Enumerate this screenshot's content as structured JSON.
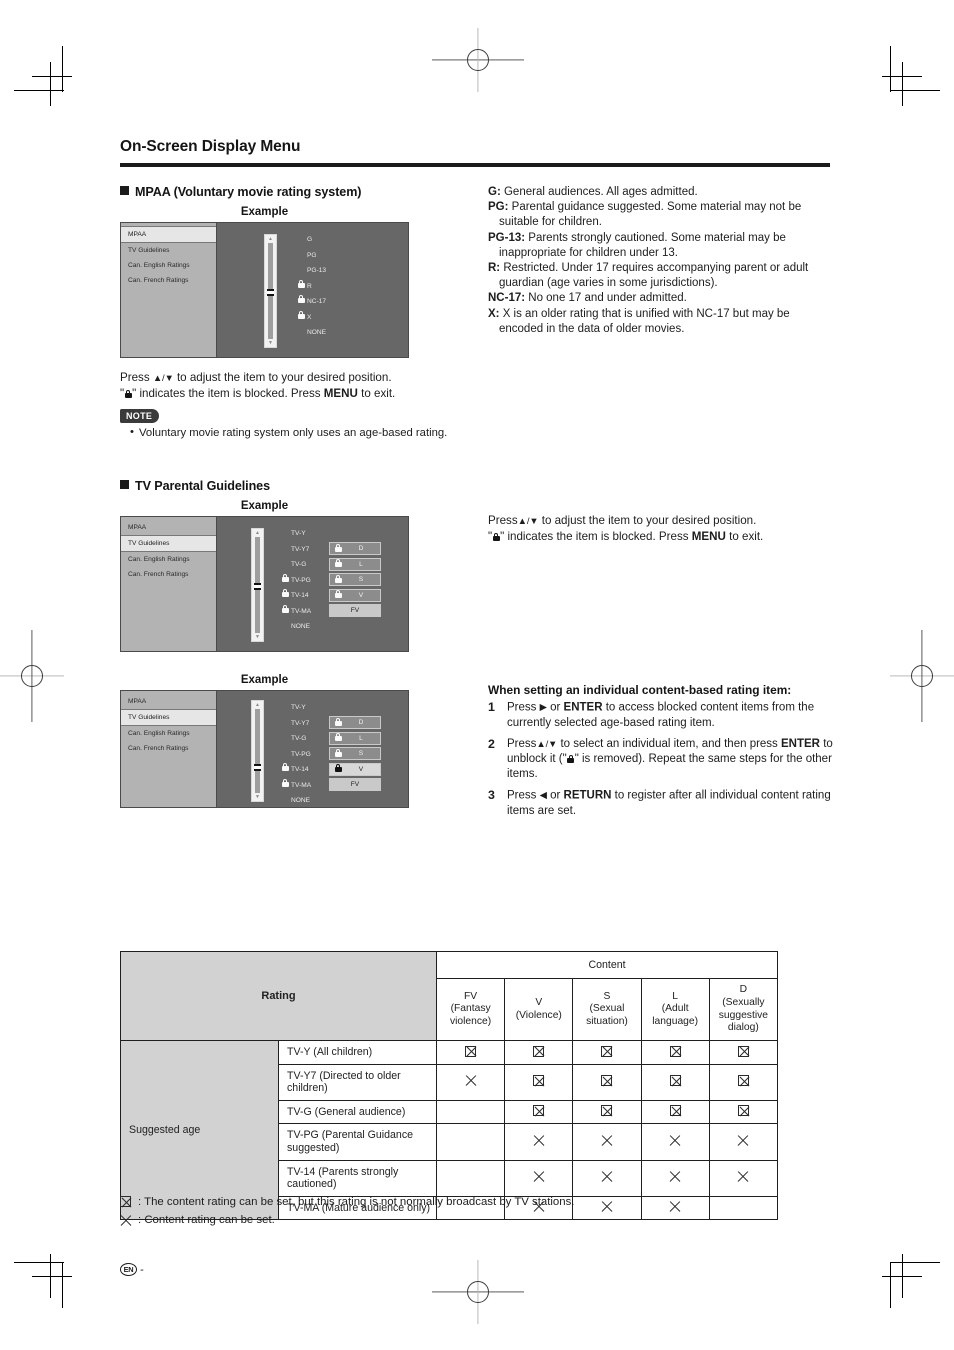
{
  "page": {
    "title": "On-Screen Display Menu",
    "page_marker": "EN",
    "page_number_dash": "-"
  },
  "mpaa_section": {
    "heading": "MPAA (Voluntary movie rating system)",
    "example_caption": "Example",
    "osd": {
      "sidebar": [
        {
          "label": "MPAA",
          "selected": true
        },
        {
          "label": "TV Guidelines",
          "selected": false
        },
        {
          "label": "Can. English Ratings",
          "selected": false
        },
        {
          "label": "Can. French Ratings",
          "selected": false
        }
      ],
      "ratings": [
        {
          "label": "G",
          "locked": false
        },
        {
          "label": "PG",
          "locked": false
        },
        {
          "label": "PG-13",
          "locked": false
        },
        {
          "label": "R",
          "locked": true
        },
        {
          "label": "NC-17",
          "locked": true
        },
        {
          "label": "X",
          "locked": true
        },
        {
          "label": "NONE",
          "locked": false
        }
      ],
      "scroll_up_arrow": "▲",
      "scroll_down_arrow": "▼"
    },
    "instruction_line1_a": "Press ",
    "instruction_line1_updown": "▲/▼",
    "instruction_line1_b": " to adjust the item to your desired position.",
    "instruction_line2_a": "\"",
    "instruction_line2_b": "\" indicates the item is blocked. Press ",
    "instruction_line2_menu": "MENU",
    "instruction_line2_c": " to exit.",
    "note_badge": "NOTE",
    "notes": [
      "Voluntary movie rating system only uses an age-based rating."
    ]
  },
  "mpaa_definitions": [
    {
      "term": "G:",
      "desc": " General audiences. All ages admitted."
    },
    {
      "term": "PG:",
      "desc": " Parental guidance suggested. Some material may not be suitable for children."
    },
    {
      "term": "PG-13:",
      "desc": " Parents strongly cautioned. Some material may be inappropriate for children under 13."
    },
    {
      "term": "R:",
      "desc": " Restricted. Under 17 requires accompanying parent or adult guardian (age varies in some jurisdictions)."
    },
    {
      "term": "NC-17:",
      "desc": " No one 17 and under admitted."
    },
    {
      "term": "X:",
      "desc": " X is an older rating that is unified with NC-17 but may be encoded in the data of older movies."
    }
  ],
  "tv_section": {
    "heading": "TV Parental Guidelines",
    "example_caption_1": "Example",
    "example_caption_2": "Example",
    "osd_common": {
      "sidebar": [
        {
          "label": "MPAA",
          "selected": false
        },
        {
          "label": "TV Guidelines",
          "selected": true
        },
        {
          "label": "Can. English Ratings",
          "selected": false
        },
        {
          "label": "Can. French Ratings",
          "selected": false
        }
      ],
      "scroll_up_arrow": "▲",
      "scroll_down_arrow": "▼"
    },
    "example1": {
      "ratings": [
        {
          "label": "TV-Y",
          "locked": false
        },
        {
          "label": "TV-Y7",
          "locked": false
        },
        {
          "label": "TV-G",
          "locked": false
        },
        {
          "label": "TV-PG",
          "locked": true
        },
        {
          "label": "TV-14",
          "locked": true
        },
        {
          "label": "TV-MA",
          "locked": true
        },
        {
          "label": "NONE",
          "locked": false
        }
      ],
      "content_boxes": [
        {
          "letter": "D",
          "locked": true,
          "highlight": false
        },
        {
          "letter": "L",
          "locked": true,
          "highlight": false
        },
        {
          "letter": "S",
          "locked": true,
          "highlight": false
        },
        {
          "letter": "V",
          "locked": true,
          "highlight": false
        },
        {
          "letter": "FV",
          "locked": false,
          "highlight": true
        }
      ]
    },
    "example2": {
      "ratings": [
        {
          "label": "TV-Y",
          "locked": false
        },
        {
          "label": "TV-Y7",
          "locked": false
        },
        {
          "label": "TV-G",
          "locked": false
        },
        {
          "label": "TV-PG",
          "locked": false
        },
        {
          "label": "TV-14",
          "locked": true
        },
        {
          "label": "TV-MA",
          "locked": true
        },
        {
          "label": "NONE",
          "locked": false
        }
      ],
      "content_boxes": [
        {
          "letter": "D",
          "locked": true,
          "highlight": false
        },
        {
          "letter": "L",
          "locked": true,
          "highlight": false
        },
        {
          "letter": "S",
          "locked": true,
          "highlight": false
        },
        {
          "letter": "V",
          "locked": true,
          "highlight": true
        },
        {
          "letter": "FV",
          "locked": false,
          "highlight": true
        }
      ]
    },
    "instruction_line1_a": "Press",
    "instruction_line1_updown": "▲/▼",
    "instruction_line1_b": " to adjust the item to your desired position.",
    "instruction_line2_b": "\" indicates the item is blocked. Press ",
    "instruction_line2_menu": "MENU",
    "instruction_line2_c": " to exit."
  },
  "individual_rating": {
    "heading": "When setting an individual content-based rating item:",
    "steps": [
      {
        "n": "1",
        "parts": [
          "Press ",
          "▶",
          " or ",
          "ENTER",
          " to access blocked content items from the currently selected age-based rating item."
        ]
      },
      {
        "n": "2",
        "parts": [
          "Press",
          "▲/▼",
          " to select an individual item, and then press ",
          "ENTER",
          " to unblock it (\"",
          "\" is removed). Repeat the same steps for the other items."
        ]
      },
      {
        "n": "3",
        "parts": [
          "Press ",
          "◀",
          " or ",
          "RETURN",
          " to register after all individual content rating items are set."
        ]
      }
    ]
  },
  "rating_table": {
    "rating_header": "Rating",
    "content_header": "Content",
    "age_group_label": "Suggested age",
    "columns": [
      {
        "letter": "FV",
        "desc": "(Fantasy violence)"
      },
      {
        "letter": "V",
        "desc": "(Violence)"
      },
      {
        "letter": "S",
        "desc": "(Sexual situation)"
      },
      {
        "letter": "L",
        "desc": "(Adult language)"
      },
      {
        "letter": "D",
        "desc": "(Sexually suggestive dialog)"
      }
    ],
    "rows": [
      {
        "label": "TV-Y (All children)",
        "marks": [
          "boxed",
          "boxed",
          "boxed",
          "boxed",
          "boxed"
        ]
      },
      {
        "label": "TV-Y7 (Directed to older children)",
        "marks": [
          "x",
          "boxed",
          "boxed",
          "boxed",
          "boxed"
        ]
      },
      {
        "label": "TV-G (General audience)",
        "marks": [
          "",
          "boxed",
          "boxed",
          "boxed",
          "boxed"
        ]
      },
      {
        "label": "TV-PG (Parental Guidance suggested)",
        "marks": [
          "",
          "x",
          "x",
          "x",
          "x"
        ]
      },
      {
        "label": "TV-14 (Parents strongly cautioned)",
        "marks": [
          "",
          "x",
          "x",
          "x",
          "x"
        ]
      },
      {
        "label": "TV-MA (Mature audience only)",
        "marks": [
          "",
          "x",
          "x",
          "x",
          ""
        ]
      }
    ],
    "legend": [
      {
        "symbol": "boxed",
        "text": ": The content rating can be set, but this rating is not normally broadcast by TV stations."
      },
      {
        "symbol": "x",
        "text": ": Content rating can be set."
      }
    ]
  },
  "colors": {
    "osd_panel_bg": "#676767",
    "osd_sidebar_bg": "#b3b3b3",
    "osd_sidebar_selected": "#e6e6e6",
    "table_header_bg": "#d2d2d2",
    "rule": "#1b1b1b"
  }
}
